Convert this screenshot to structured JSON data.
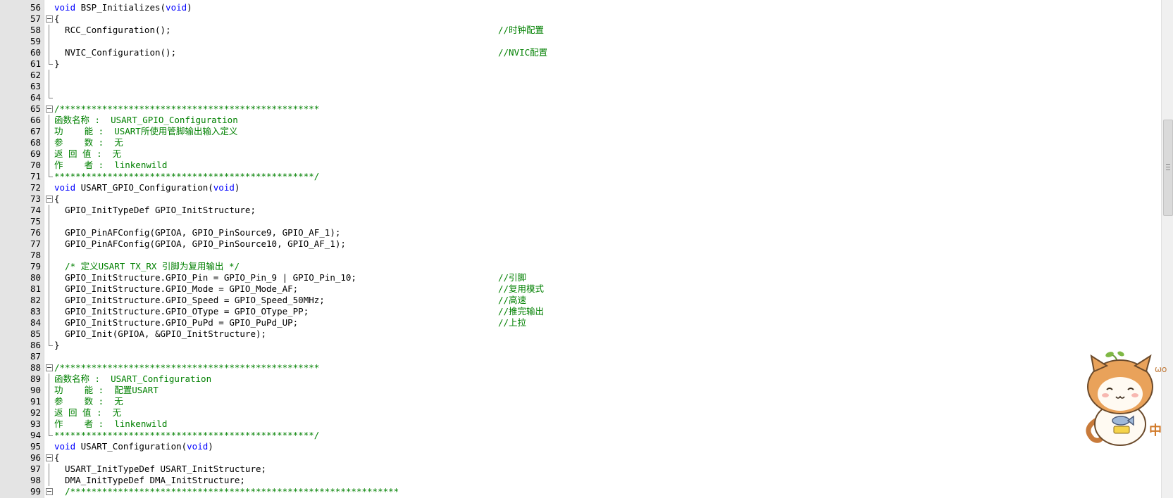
{
  "lines": [
    {
      "n": "56",
      "fold": "",
      "parts": [
        {
          "t": "void",
          "c": "kw"
        },
        {
          "t": " BSP_Initializes(",
          "c": "pl"
        },
        {
          "t": "void",
          "c": "kw"
        },
        {
          "t": ")",
          "c": "pl"
        }
      ],
      "trail": ""
    },
    {
      "n": "57",
      "fold": "open",
      "parts": [
        {
          "t": "{",
          "c": "pl"
        }
      ],
      "trail": ""
    },
    {
      "n": "58",
      "fold": "line",
      "parts": [
        {
          "t": "  RCC_Configuration();",
          "c": "pl"
        }
      ],
      "trail": "//时钟配置"
    },
    {
      "n": "59",
      "fold": "line",
      "parts": [],
      "trail": ""
    },
    {
      "n": "60",
      "fold": "line",
      "parts": [
        {
          "t": "  NVIC_Configuration();",
          "c": "pl"
        }
      ],
      "trail": "//NVIC配置"
    },
    {
      "n": "61",
      "fold": "end",
      "parts": [
        {
          "t": "}",
          "c": "pl"
        }
      ],
      "trail": ""
    },
    {
      "n": "62",
      "fold": "line",
      "parts": [],
      "trail": ""
    },
    {
      "n": "63",
      "fold": "line",
      "parts": [],
      "trail": ""
    },
    {
      "n": "64",
      "fold": "end",
      "parts": [],
      "trail": ""
    },
    {
      "n": "65",
      "fold": "open",
      "parts": [
        {
          "t": "/*************************************************",
          "c": "cm"
        }
      ],
      "trail": ""
    },
    {
      "n": "66",
      "fold": "line",
      "parts": [
        {
          "t": "函数名称 :  USART_GPIO_Configuration",
          "c": "cm"
        }
      ],
      "trail": ""
    },
    {
      "n": "67",
      "fold": "line",
      "parts": [
        {
          "t": "功    能 :  USART所使用管脚输出输入定义",
          "c": "cm"
        }
      ],
      "trail": ""
    },
    {
      "n": "68",
      "fold": "line",
      "parts": [
        {
          "t": "参    数 :  无",
          "c": "cm"
        }
      ],
      "trail": ""
    },
    {
      "n": "69",
      "fold": "line",
      "parts": [
        {
          "t": "返 回 值 :  无",
          "c": "cm"
        }
      ],
      "trail": ""
    },
    {
      "n": "70",
      "fold": "line",
      "parts": [
        {
          "t": "作    者 :  linkenwild",
          "c": "cm"
        }
      ],
      "trail": ""
    },
    {
      "n": "71",
      "fold": "end",
      "parts": [
        {
          "t": "*************************************************/",
          "c": "cm"
        }
      ],
      "trail": ""
    },
    {
      "n": "72",
      "fold": "",
      "parts": [
        {
          "t": "void",
          "c": "kw"
        },
        {
          "t": " USART_GPIO_Configuration(",
          "c": "pl"
        },
        {
          "t": "void",
          "c": "kw"
        },
        {
          "t": ")",
          "c": "pl"
        }
      ],
      "trail": ""
    },
    {
      "n": "73",
      "fold": "open",
      "parts": [
        {
          "t": "{",
          "c": "pl"
        }
      ],
      "trail": ""
    },
    {
      "n": "74",
      "fold": "line",
      "parts": [
        {
          "t": "  GPIO_InitTypeDef GPIO_InitStructure;",
          "c": "pl"
        }
      ],
      "trail": ""
    },
    {
      "n": "75",
      "fold": "line",
      "parts": [],
      "trail": ""
    },
    {
      "n": "76",
      "fold": "line",
      "parts": [
        {
          "t": "  GPIO_PinAFConfig(GPIOA, GPIO_PinSource9, GPIO_AF_1);",
          "c": "pl"
        }
      ],
      "trail": ""
    },
    {
      "n": "77",
      "fold": "line",
      "parts": [
        {
          "t": "  GPIO_PinAFConfig(GPIOA, GPIO_PinSource10, GPIO_AF_1);",
          "c": "pl"
        }
      ],
      "trail": ""
    },
    {
      "n": "78",
      "fold": "line",
      "parts": [],
      "trail": ""
    },
    {
      "n": "79",
      "fold": "line",
      "parts": [
        {
          "t": "  /* 定义USART TX_RX 引脚为复用输出 */",
          "c": "cm"
        }
      ],
      "trail": ""
    },
    {
      "n": "80",
      "fold": "line",
      "parts": [
        {
          "t": "  GPIO_InitStructure.GPIO_Pin = GPIO_Pin_9 | GPIO_Pin_10;",
          "c": "pl"
        }
      ],
      "trail": "//引脚"
    },
    {
      "n": "81",
      "fold": "line",
      "parts": [
        {
          "t": "  GPIO_InitStructure.GPIO_Mode = GPIO_Mode_AF;",
          "c": "pl"
        }
      ],
      "trail": "//复用模式"
    },
    {
      "n": "82",
      "fold": "line",
      "parts": [
        {
          "t": "  GPIO_InitStructure.GPIO_Speed = GPIO_Speed_50MHz;",
          "c": "pl"
        }
      ],
      "trail": "//高速"
    },
    {
      "n": "83",
      "fold": "line",
      "parts": [
        {
          "t": "  GPIO_InitStructure.GPIO_OType = GPIO_OType_PP;",
          "c": "pl"
        }
      ],
      "trail": "//推完输出"
    },
    {
      "n": "84",
      "fold": "line",
      "parts": [
        {
          "t": "  GPIO_InitStructure.GPIO_PuPd = GPIO_PuPd_UP;",
          "c": "pl"
        }
      ],
      "trail": "//上拉"
    },
    {
      "n": "85",
      "fold": "line",
      "parts": [
        {
          "t": "  GPIO_Init(GPIOA, &GPIO_InitStructure);",
          "c": "pl"
        }
      ],
      "trail": ""
    },
    {
      "n": "86",
      "fold": "end",
      "parts": [
        {
          "t": "}",
          "c": "pl"
        }
      ],
      "trail": ""
    },
    {
      "n": "87",
      "fold": "",
      "parts": [],
      "trail": ""
    },
    {
      "n": "88",
      "fold": "open",
      "parts": [
        {
          "t": "/*************************************************",
          "c": "cm"
        }
      ],
      "trail": ""
    },
    {
      "n": "89",
      "fold": "line",
      "parts": [
        {
          "t": "函数名称 :  USART_Configuration",
          "c": "cm"
        }
      ],
      "trail": ""
    },
    {
      "n": "90",
      "fold": "line",
      "parts": [
        {
          "t": "功    能 :  配置USART",
          "c": "cm"
        }
      ],
      "trail": ""
    },
    {
      "n": "91",
      "fold": "line",
      "parts": [
        {
          "t": "参    数 :  无",
          "c": "cm"
        }
      ],
      "trail": ""
    },
    {
      "n": "92",
      "fold": "line",
      "parts": [
        {
          "t": "返 回 值 :  无",
          "c": "cm"
        }
      ],
      "trail": ""
    },
    {
      "n": "93",
      "fold": "line",
      "parts": [
        {
          "t": "作    者 :  linkenwild",
          "c": "cm"
        }
      ],
      "trail": ""
    },
    {
      "n": "94",
      "fold": "end",
      "parts": [
        {
          "t": "*************************************************/",
          "c": "cm"
        }
      ],
      "trail": ""
    },
    {
      "n": "95",
      "fold": "",
      "parts": [
        {
          "t": "void",
          "c": "kw"
        },
        {
          "t": " USART_Configuration(",
          "c": "pl"
        },
        {
          "t": "void",
          "c": "kw"
        },
        {
          "t": ")",
          "c": "pl"
        }
      ],
      "trail": ""
    },
    {
      "n": "96",
      "fold": "open",
      "parts": [
        {
          "t": "{",
          "c": "pl"
        }
      ],
      "trail": ""
    },
    {
      "n": "97",
      "fold": "line",
      "parts": [
        {
          "t": "  USART_InitTypeDef USART_InitStructure;",
          "c": "pl"
        }
      ],
      "trail": ""
    },
    {
      "n": "98",
      "fold": "line",
      "parts": [
        {
          "t": "  DMA_InitTypeDef DMA_InitStructure;",
          "c": "pl"
        }
      ],
      "trail": ""
    },
    {
      "n": "99",
      "fold": "open",
      "parts": [
        {
          "t": "  /**************************************************************",
          "c": "cm"
        }
      ],
      "trail": ""
    }
  ],
  "mascot": {
    "badge_text": "中",
    "bubble_text": "ωo"
  },
  "colors": {
    "keyword": "#0000ff",
    "comment": "#008000",
    "gutter": "#e4e4e4"
  },
  "icons": [
    "fold-open-icon",
    "scroll-thumb-grip-icon",
    "cat-mascot-icon"
  ]
}
